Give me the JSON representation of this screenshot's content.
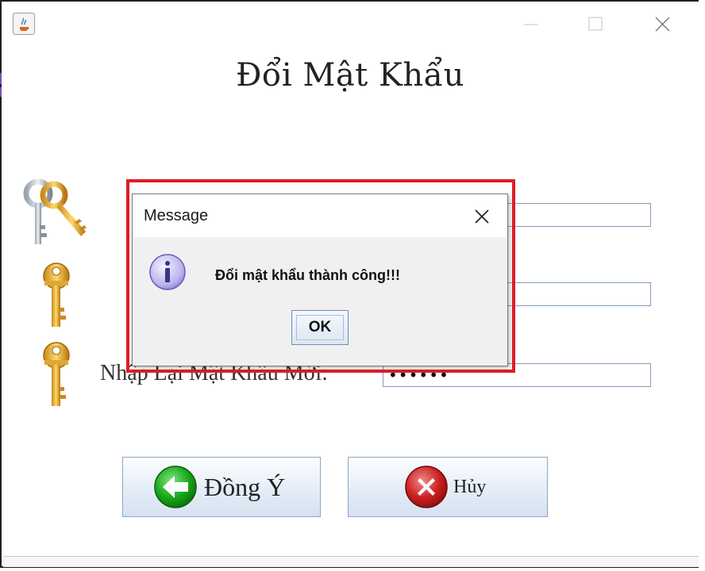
{
  "window": {
    "minimize_glyph": "—",
    "maximize_glyph": "☐",
    "close_glyph": "✕"
  },
  "form": {
    "title": "Đổi Mật Khẩu",
    "fields": [
      {
        "label": "",
        "value": "",
        "icon": "keys-icon"
      },
      {
        "label": "",
        "value": "",
        "icon": "key-icon"
      },
      {
        "label": "Nhập Lại Mật Khẩu Mới:",
        "value": "••••••",
        "icon": "key-icon"
      }
    ],
    "buttons": {
      "agree_label": "Đồng Ý",
      "cancel_label": "Hủy"
    }
  },
  "dialog": {
    "title": "Message",
    "message": "Đổi mật khẩu thành công!!!",
    "ok_label": "OK",
    "icon": "info-icon"
  },
  "colors": {
    "highlight": "#e01c26",
    "dialog_bg": "#f0f0f0",
    "button_border": "#8aa6c6"
  }
}
